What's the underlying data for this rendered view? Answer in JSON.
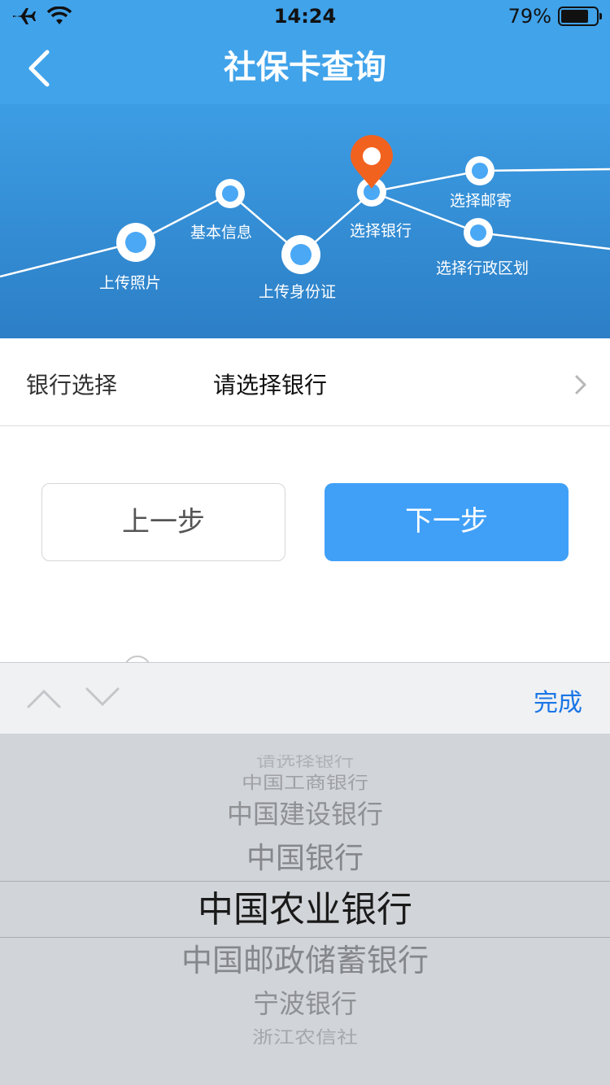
{
  "status_bar": {
    "time": "14:24",
    "battery_text": "79%",
    "battery_level": 0.79,
    "icons": [
      "airplane-icon",
      "wifi-icon",
      "battery-icon"
    ]
  },
  "nav": {
    "title": "社保卡查询",
    "back_icon": "chevron-left-icon"
  },
  "progress": {
    "steps": [
      {
        "label": "上传照片"
      },
      {
        "label": "基本信息"
      },
      {
        "label": "上传身份证"
      },
      {
        "label": "选择银行",
        "current": true
      },
      {
        "label": "选择邮寄"
      },
      {
        "label": "选择行政区划"
      }
    ],
    "current_marker_icon": "map-pin-icon"
  },
  "form": {
    "bank_label": "银行选择",
    "bank_value": "请选择银行",
    "chevron_icon": "chevron-right-icon"
  },
  "buttons": {
    "prev": "上一步",
    "next": "下一步"
  },
  "toolbar": {
    "up_icon": "chevron-up-icon",
    "down_icon": "chevron-down-icon",
    "done": "完成"
  },
  "picker": {
    "options": [
      "请选择银行",
      "中国工商银行",
      "中国建设银行",
      "中国银行",
      "中国农业银行",
      "中国邮政储蓄银行",
      "宁波银行",
      "浙江农信社"
    ],
    "selected": "中国农业银行"
  },
  "colors": {
    "brand": "#41a3ea",
    "primary_button": "#40a0f8",
    "marker": "#f2621f",
    "link": "#1976e6"
  }
}
